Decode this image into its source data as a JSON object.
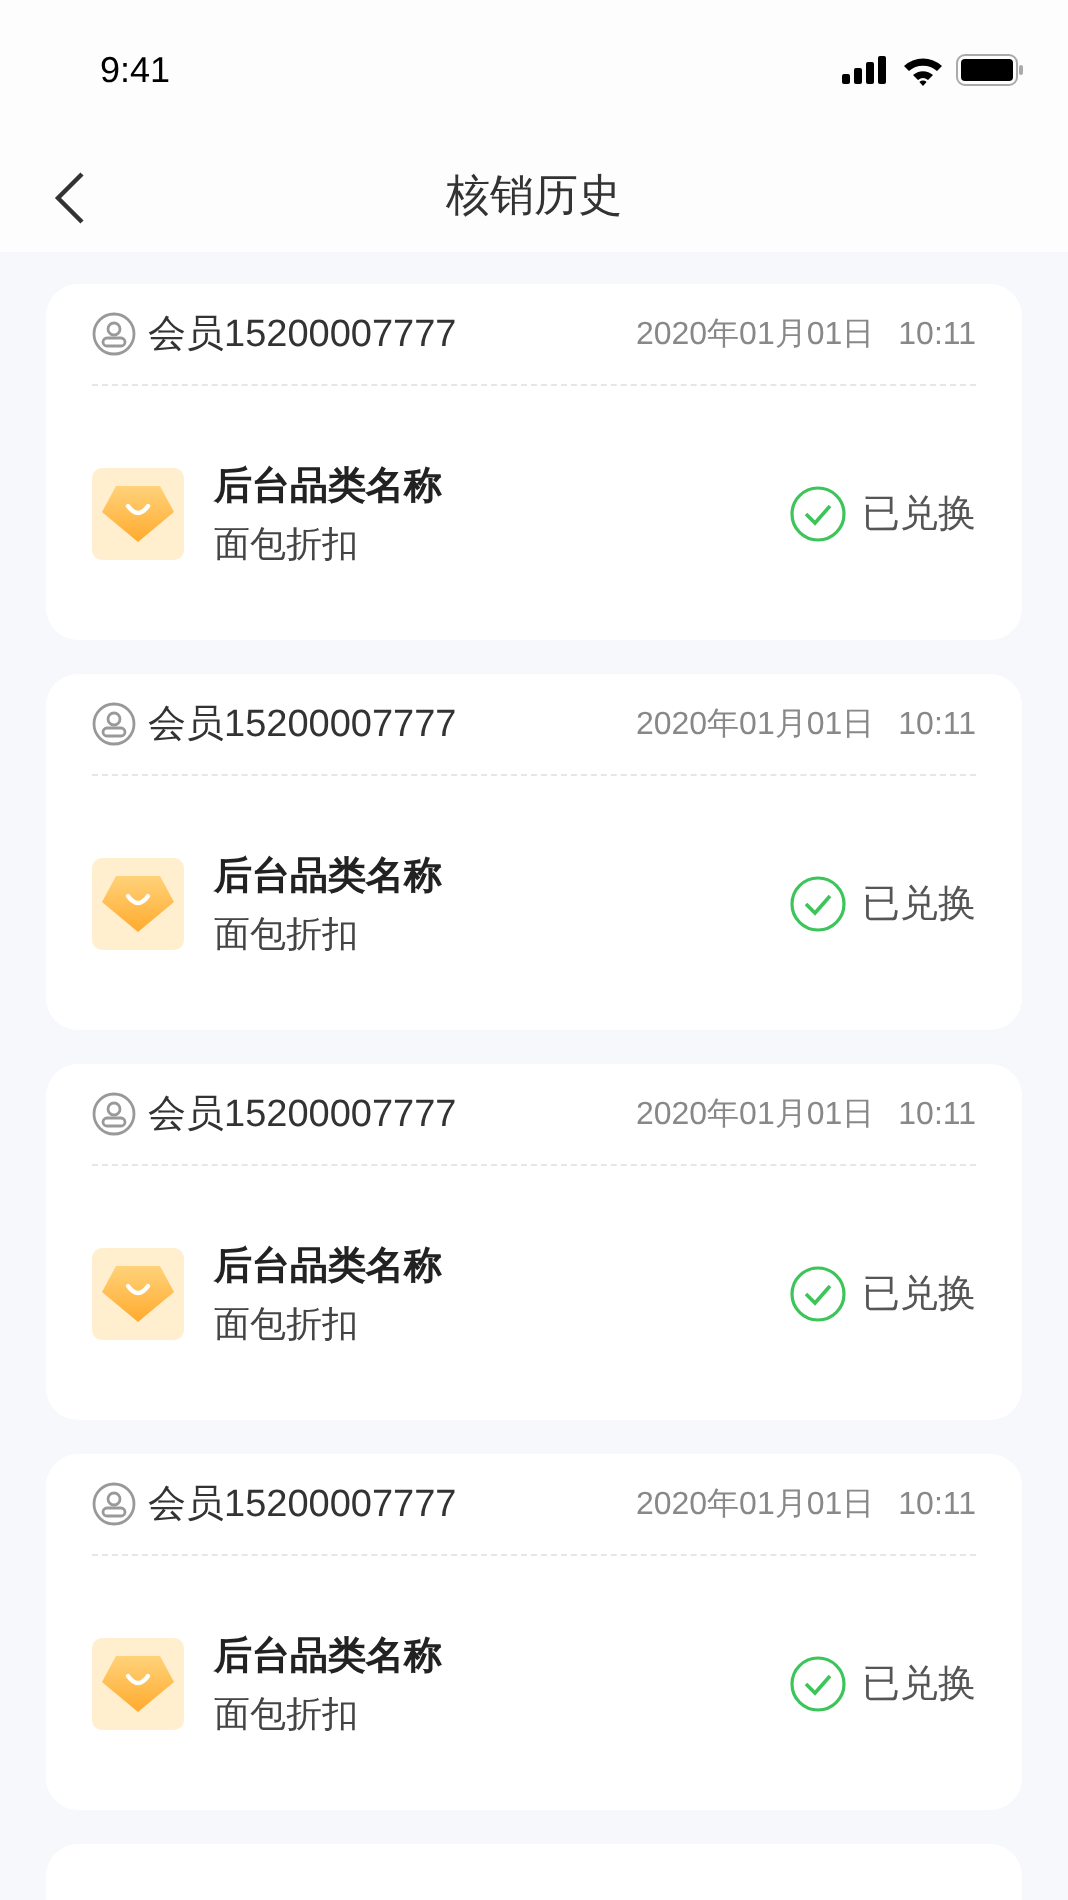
{
  "status_bar": {
    "time": "9:41"
  },
  "nav": {
    "title": "核销历史"
  },
  "records": [
    {
      "member": "会员15200007777",
      "date": "2020年01月01日",
      "time": "10:11",
      "name": "后台品类名称",
      "desc": "面包折扣",
      "status": "已兑换",
      "redeemed": true
    },
    {
      "member": "会员15200007777",
      "date": "2020年01月01日",
      "time": "10:11",
      "name": "后台品类名称",
      "desc": "面包折扣",
      "status": "已兑换",
      "redeemed": true
    },
    {
      "member": "会员15200007777",
      "date": "2020年01月01日",
      "time": "10:11",
      "name": "后台品类名称",
      "desc": "面包折扣",
      "status": "已兑换",
      "redeemed": true
    },
    {
      "member": "会员15200007777",
      "date": "2020年01月01日",
      "time": "10:11",
      "name": "后台品类名称",
      "desc": "面包折扣",
      "status": "已兑换",
      "redeemed": true
    }
  ]
}
